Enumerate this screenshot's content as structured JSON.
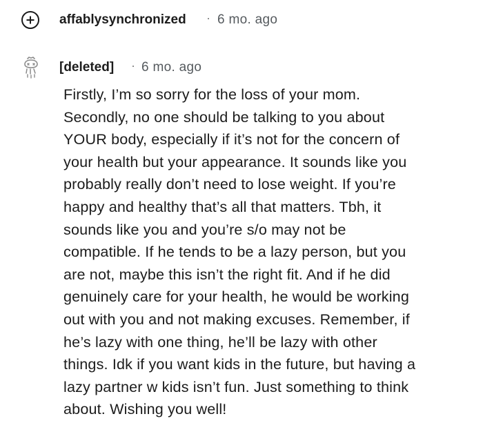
{
  "collapsed_comment": {
    "author": "affablysynchronized",
    "separator": "·",
    "timestamp": "6 mo. ago",
    "expand_icon": "plus-circle-icon"
  },
  "deleted_comment": {
    "author": "[deleted]",
    "separator": "·",
    "timestamp": "6 mo. ago",
    "avatar_icon": "deleted-user-avatar-icon",
    "body_lines": [
      "Firstly, I’m so sorry for the loss of your mom.",
      "Secondly, no one should be talking to you about",
      "YOUR body, especially if it’s not for the concern of",
      "your health but your appearance. It sounds like you",
      "probably really don’t need to lose weight. If you’re",
      "happy and healthy that’s all that matters. Tbh, it",
      "sounds like you and you’re s/o may not be",
      "compatible. If he tends to be a lazy person, but you",
      "are not, maybe this isn’t the right fit. And if he did",
      "genuinely care for your health, he would be working",
      "out with you and not making excuses. Remember, if",
      "he’s lazy with one thing, he’ll be lazy with other",
      "things. Idk if you want kids in the future, but having a",
      "lazy partner w kids isn’t fun. Just something to think",
      "about. Wishing you well!"
    ]
  }
}
